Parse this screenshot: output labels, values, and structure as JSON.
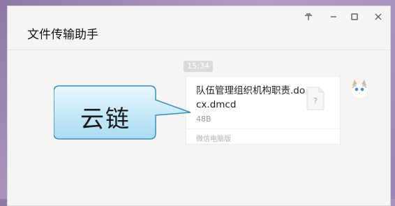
{
  "window": {
    "title": "文件传输助手",
    "controls": {
      "pin_icon": "pin-icon",
      "min_icon": "minimize-icon",
      "max_icon": "maximize-icon",
      "close_icon": "close-icon"
    }
  },
  "chat": {
    "timestamp": "15:34",
    "message": {
      "file_name": "队伍管理组织机构职责.docx.dmcd",
      "file_size": "48B",
      "source": "微信电脑版",
      "file_icon": "unknown-file-icon",
      "avatar": "cat-avatar"
    }
  },
  "annotation": {
    "callout_text": "云链",
    "colors": {
      "fill_top": "#e8f7ff",
      "fill_bottom": "#a9dcf2",
      "stroke": "#3a8fb6"
    }
  }
}
